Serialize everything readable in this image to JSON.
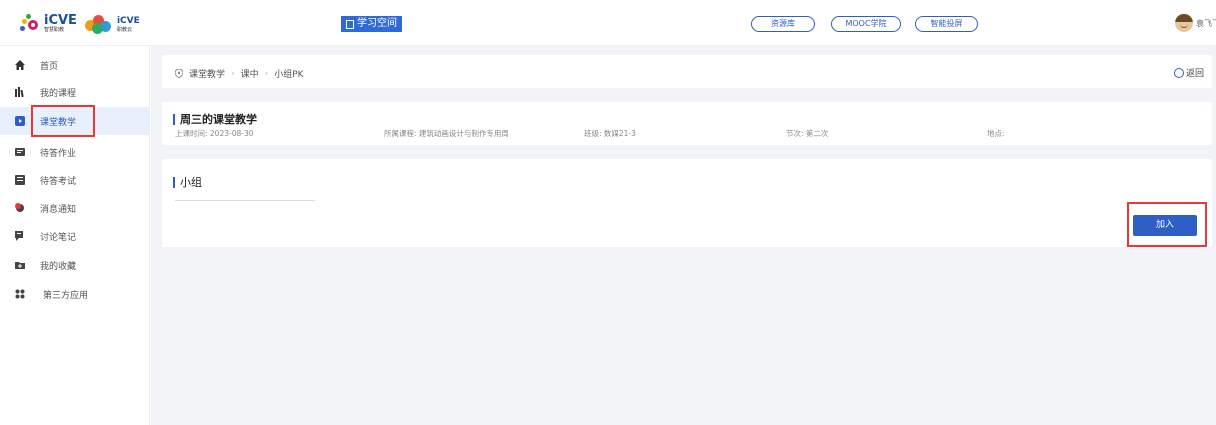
{
  "header": {
    "logo_text": "iCVE",
    "logo_sub": "智慧职教",
    "logo2_text": "iCVE",
    "logo2_sub": "职教云",
    "space_label": "学习空间",
    "nav": [
      {
        "label": "资源库"
      },
      {
        "label": "MOOC学院"
      },
      {
        "label": "智能投屏"
      }
    ],
    "user_name": "袁飞飞"
  },
  "sidebar": {
    "items": [
      {
        "label": "首页",
        "icon": "home-icon"
      },
      {
        "label": "我的课程",
        "icon": "books-icon"
      },
      {
        "label": "课堂教学",
        "icon": "play-icon",
        "active": true
      },
      {
        "label": "待答作业",
        "icon": "homework-icon"
      },
      {
        "label": "待答考试",
        "icon": "exam-icon"
      },
      {
        "label": "消息通知",
        "icon": "message-icon"
      },
      {
        "label": "讨论笔记",
        "icon": "discussion-icon"
      },
      {
        "label": "我的收藏",
        "icon": "folder-icon"
      },
      {
        "label": "第三方应用",
        "icon": "apps-icon"
      }
    ]
  },
  "breadcrumb": {
    "items": [
      "课堂教学",
      "课中",
      "小组PK"
    ],
    "back_label": "返回"
  },
  "lesson": {
    "title": "周三的课堂教学",
    "time": "上课时间: 2023-08-30",
    "course": "所属课程: 建筑动画设计与制作专用周",
    "class": "班级: 数媒21-3",
    "session": "节次: 第二次",
    "place": "地点:"
  },
  "group": {
    "title": "小组",
    "join_label": "加入"
  },
  "colors": {
    "accent": "#2f5fc4",
    "highlight": "#e53935",
    "background": "#f2f3f6"
  }
}
